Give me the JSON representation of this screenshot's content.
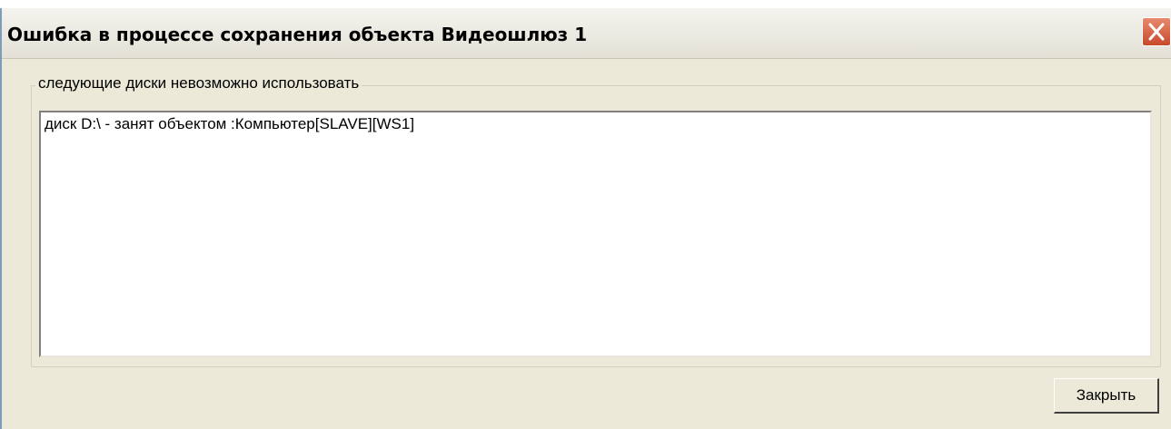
{
  "window": {
    "title": "Ошибка в процессе сохранения объекта Видеошлюз 1",
    "close_icon": "close-icon",
    "colors": {
      "background": "#ece9d8",
      "close_button": "#c8492b"
    }
  },
  "group": {
    "label": "следующие диски невозможно использовать",
    "items": [
      "диск D:\\ - занят объектом :Компьютер[SLAVE][WS1]"
    ]
  },
  "buttons": {
    "close_label": "Закрыть"
  }
}
